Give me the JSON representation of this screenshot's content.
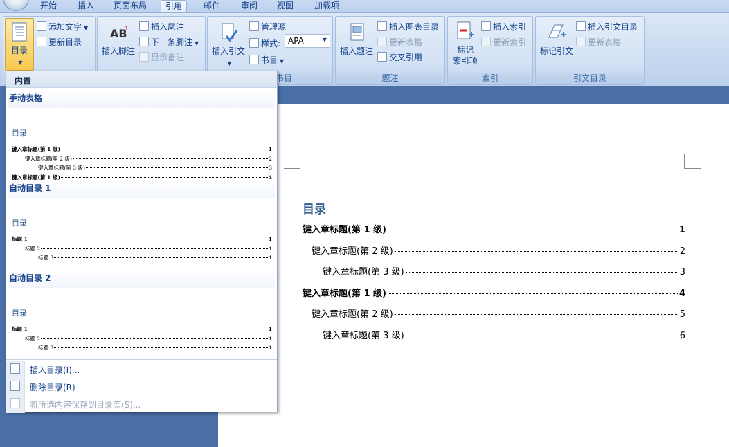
{
  "tabs": [
    "开始",
    "插入",
    "页面布局",
    "引用",
    "邮件",
    "审阅",
    "视图",
    "加载项"
  ],
  "active_tab": "引用",
  "ribbon": {
    "toc_group": {
      "toc_button": "目录",
      "add_text": "添加文字",
      "update_toc": "更新目录"
    },
    "footnotes_group": {
      "insert_footnote": "插入脚注",
      "insert_endnote": "插入尾注",
      "next_footnote": "下一条脚注",
      "show_notes": "显示备注"
    },
    "citations_group": {
      "insert_citation": "插入引文",
      "manage_sources": "管理源",
      "style_label": "样式:",
      "style_value": "APA",
      "bibliography": "书目",
      "label_tail": "书目"
    },
    "captions_group": {
      "insert_caption": "插入题注",
      "insert_table_of_figures": "插入图表目录",
      "update_table": "更新表格",
      "cross_reference": "交叉引用",
      "label": "题注"
    },
    "index_group": {
      "mark_entry_line1": "标记",
      "mark_entry_line2": "索引项",
      "insert_index": "插入索引",
      "update_index": "更新索引",
      "label": "索引"
    },
    "toa_group": {
      "mark_citation": "标记引文",
      "insert_toa": "插入引文目录",
      "update_table": "更新表格",
      "label": "引文目录"
    }
  },
  "document": {
    "toc_title": "目录",
    "toc_entries": [
      {
        "text": "键入章标题(第 1 级)",
        "page": "1",
        "level": 1
      },
      {
        "text": "键入章标题(第 2 级)",
        "page": "2",
        "level": 2
      },
      {
        "text": "键入章标题(第 3 级)",
        "page": "3",
        "level": 3
      },
      {
        "text": "键入章标题(第 1 级)",
        "page": "4",
        "level": 1
      },
      {
        "text": "键入章标题(第 2 级)",
        "page": "5",
        "level": 2
      },
      {
        "text": "键入章标题(第 3 级)",
        "page": "6",
        "level": 3
      }
    ]
  },
  "dropdown": {
    "section_header": "内置",
    "gallery": [
      {
        "title": "手动表格",
        "preview_title": "目录",
        "lines": [
          {
            "text": "键入章标题(第 1 级)",
            "page": "1",
            "level": 1
          },
          {
            "text": "键入章标题(第 2 级)",
            "page": "2",
            "level": 2
          },
          {
            "text": "键入章标题(第 3 级)",
            "page": "3",
            "level": 3
          },
          {
            "text": "键入章标题(第 1 级)",
            "page": "4",
            "level": 1
          }
        ]
      },
      {
        "title": "自动目录 1",
        "preview_title": "目录",
        "lines": [
          {
            "text": "标题 1",
            "page": "1",
            "level": 1
          },
          {
            "text": "标题 2",
            "page": "1",
            "level": 2
          },
          {
            "text": "标题 3",
            "page": "1",
            "level": 3
          }
        ]
      },
      {
        "title": "自动目录 2",
        "preview_title": "目录",
        "lines": [
          {
            "text": "标题 1",
            "page": "1",
            "level": 1
          },
          {
            "text": "标题 2",
            "page": "1",
            "level": 2
          },
          {
            "text": "标题 3",
            "page": "1",
            "level": 3
          }
        ]
      }
    ],
    "commands": [
      {
        "label": "插入目录(I)...",
        "enabled": true
      },
      {
        "label": "删除目录(R)",
        "enabled": true
      },
      {
        "label": "将所选内容保存到目录库(S)...",
        "enabled": false
      }
    ]
  },
  "colors": {
    "ribbon_text": "#15428b",
    "doc_background": "#4a6fa6",
    "heading_blue": "#365f91"
  }
}
